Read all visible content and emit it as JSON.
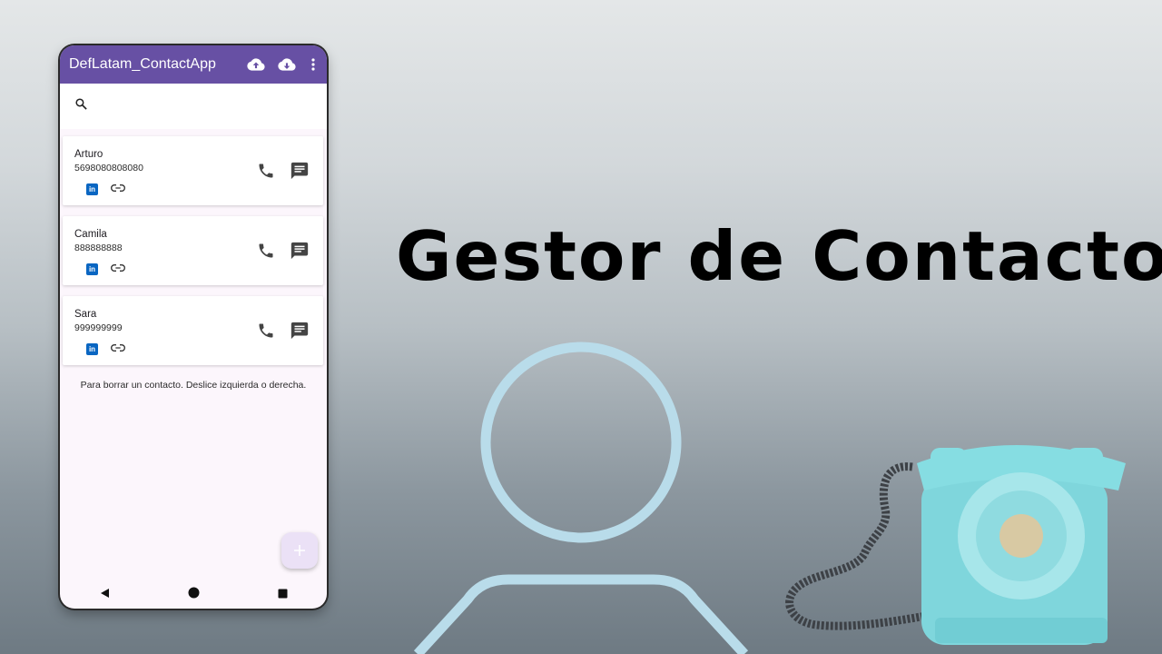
{
  "app": {
    "title": "DefLatam_ContactApp",
    "icons": [
      "cloud-upload-icon",
      "cloud-download-icon",
      "more-vert-icon"
    ]
  },
  "search": {
    "placeholder": ""
  },
  "contacts": [
    {
      "name": "Arturo",
      "phone": "5698080808080"
    },
    {
      "name": "Camila",
      "phone": "888888888"
    },
    {
      "name": "Sara",
      "phone": "999999999"
    }
  ],
  "hint": "Para borrar un contacto. Deslice izquierda o derecha.",
  "fab_icon": "plus-icon",
  "headline": "Gestor de Contactos",
  "colors": {
    "appbar": "#6750a4",
    "screen_bg": "#fcf6fc",
    "linkedin": "#0a66c2",
    "person_outline": "#b9dcea",
    "telephone": "#7fd6dc"
  }
}
